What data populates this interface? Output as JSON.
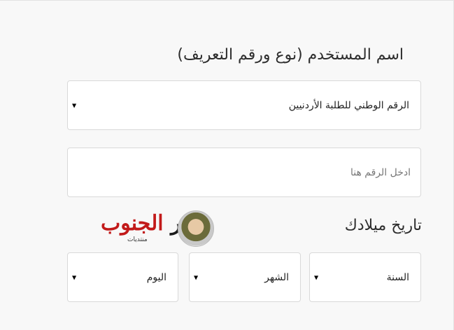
{
  "id_section": {
    "heading": "اسم المستخدم (نوع ورقم التعريف)",
    "type_select": {
      "value": "الرقم الوطني للطلبة الأردنيين"
    },
    "number_input": {
      "placeholder": "ادخل الرقم هنا",
      "value": ""
    }
  },
  "dob_section": {
    "heading": "تاريخ ميلادك",
    "year": {
      "value": "السنة"
    },
    "month": {
      "value": "الشهر"
    },
    "day": {
      "value": "اليوم"
    }
  },
  "logo": {
    "name": "صقر الجنوب",
    "subtitle": "منتديات"
  },
  "icons": {
    "dropdown": "triangle-down-icon"
  }
}
